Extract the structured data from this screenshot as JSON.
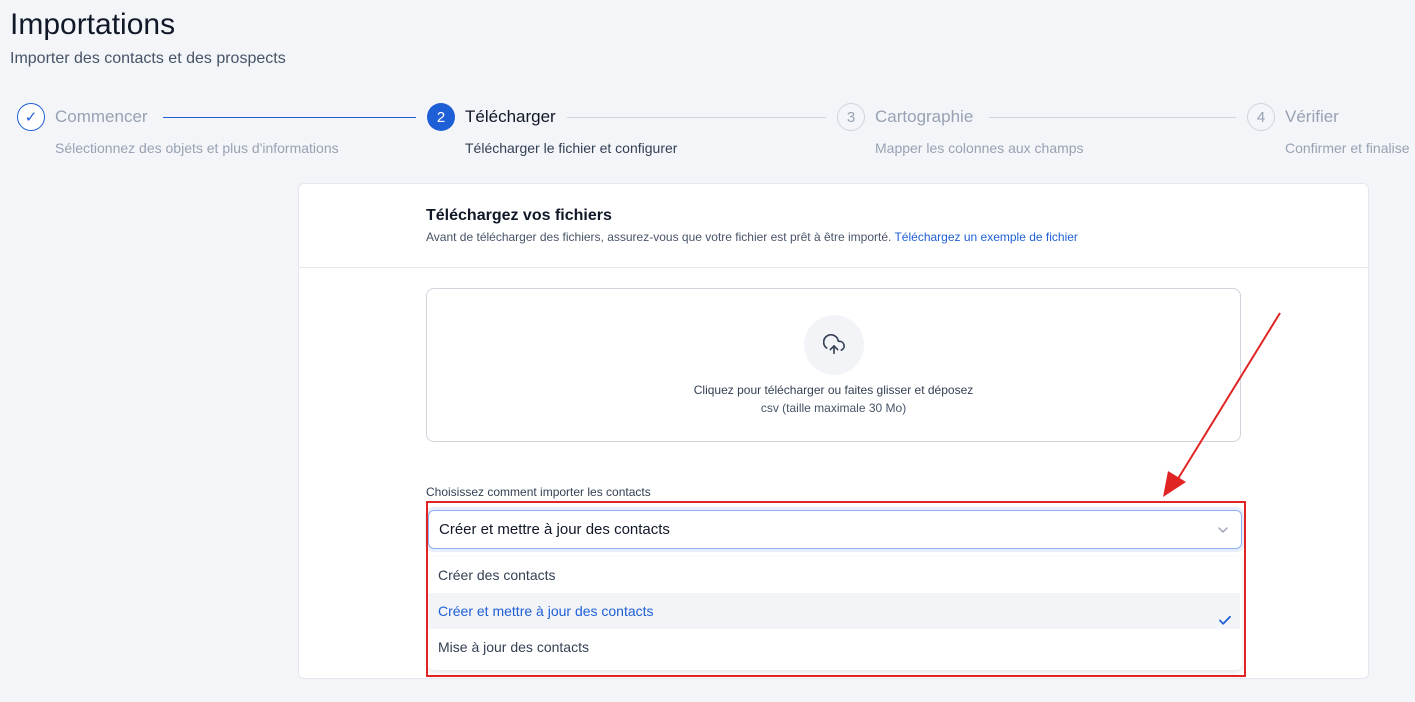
{
  "header": {
    "title": "Importations",
    "subtitle": "Importer des contacts et des prospects"
  },
  "stepper": {
    "steps": [
      {
        "number": "✓",
        "label": "Commencer",
        "description": "Sélectionnez des objets et plus d'informations",
        "state": "done"
      },
      {
        "number": "2",
        "label": "Télécharger",
        "description": "Télécharger le fichier et configurer",
        "state": "active"
      },
      {
        "number": "3",
        "label": "Cartographie",
        "description": "Mapper les colonnes aux champs",
        "state": "pending"
      },
      {
        "number": "4",
        "label": "Vérifier",
        "description": "Confirmer et finalise",
        "state": "pending"
      }
    ]
  },
  "upload_card": {
    "title": "Téléchargez vos fichiers",
    "subtitle": "Avant de télécharger des fichiers, assurez-vous que votre fichier est prêt à être importé.",
    "sample_link": "Téléchargez un exemple de fichier",
    "dropzone": {
      "icon": "cloud-upload-icon",
      "text": "Cliquez pour télécharger ou faites glisser et déposez",
      "hint": "csv (taille maximale 30 Mo)"
    }
  },
  "import_mode": {
    "label": "Choisissez comment importer les contacts",
    "selected_value": "Créer et mettre à jour des contacts",
    "options": [
      {
        "label": "Créer des contacts",
        "selected": false
      },
      {
        "label": "Créer et mettre à jour des contacts",
        "selected": true
      },
      {
        "label": "Mise à jour des contacts",
        "selected": false
      }
    ]
  },
  "colors": {
    "accent": "#1f5fd6",
    "annotation": "#e02424"
  }
}
